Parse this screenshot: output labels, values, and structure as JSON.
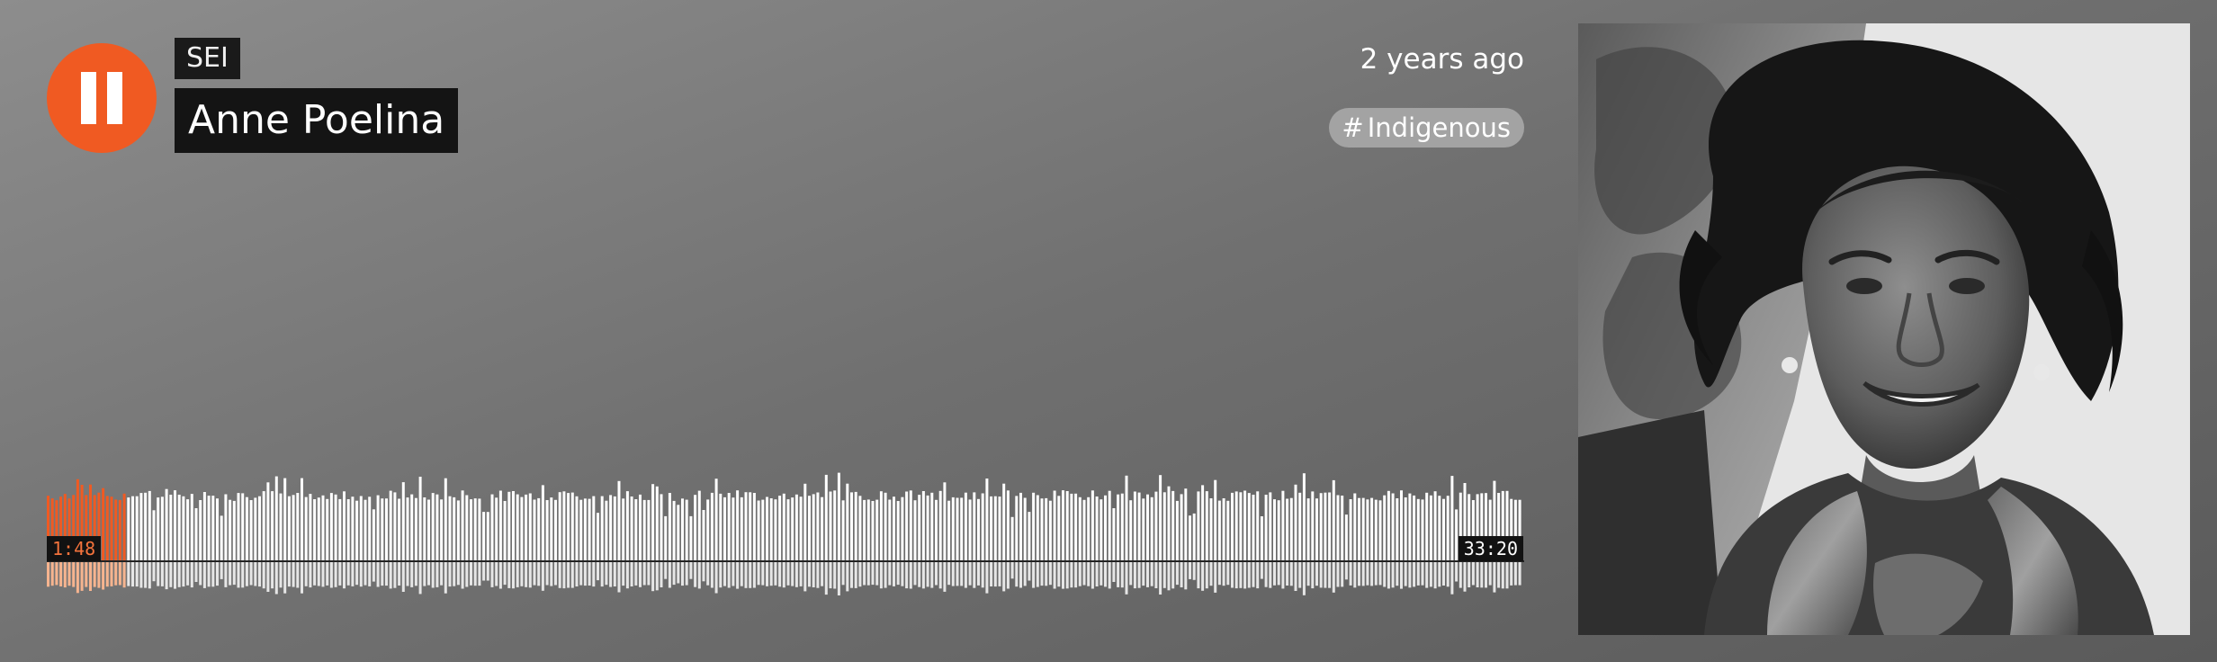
{
  "player": {
    "state": "playing",
    "pause_icon": "pause-icon",
    "artist": "SEI",
    "title": "Anne Poelina",
    "posted": "2 years ago",
    "tag": {
      "hash": "#",
      "label": "Indigenous"
    },
    "progress": {
      "elapsed": "1:48",
      "duration": "33:20",
      "fraction": 0.054
    },
    "artwork": {
      "subject": "portrait-photo",
      "style": "black-and-white"
    }
  },
  "colors": {
    "accent": "#f05a22",
    "played_bar": "#f05a22",
    "played_bar_reflection": "#f6b48f",
    "unplayed_bar": "#ffffff",
    "unplayed_bar_reflection": "#e6e6e6",
    "label_background": "#141414",
    "tag_background": "#a3a3a3"
  }
}
